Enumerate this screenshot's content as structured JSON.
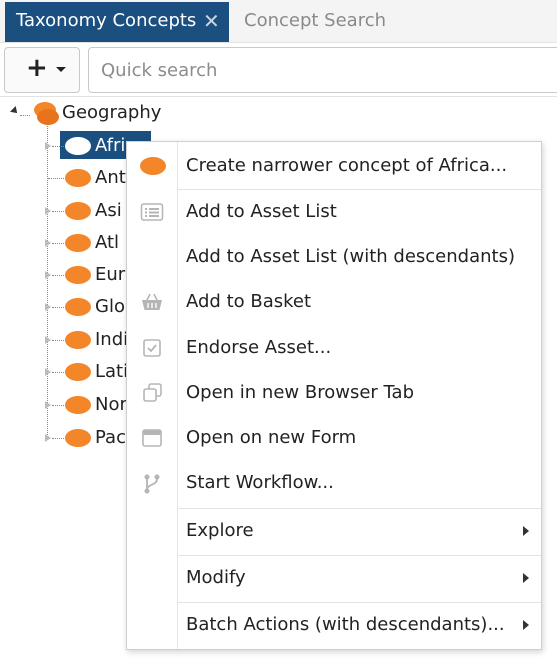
{
  "tabs": [
    {
      "label": "Taxonomy Concepts",
      "active": true
    },
    {
      "label": "Concept Search",
      "active": false
    }
  ],
  "toolbar": {
    "add_symbol": "+"
  },
  "search": {
    "placeholder": "Quick search",
    "value": ""
  },
  "tree": {
    "root": {
      "label": "Geography",
      "expanded": true
    },
    "children": [
      {
        "label": "Africa",
        "shown": "Afric",
        "selected": true
      },
      {
        "label": "Ant",
        "shown": "Ant"
      },
      {
        "label": "Asi",
        "shown": "Asi"
      },
      {
        "label": "Atl",
        "shown": "Atl"
      },
      {
        "label": "Eur",
        "shown": "Eur"
      },
      {
        "label": "Glo",
        "shown": "Glo"
      },
      {
        "label": "Indi",
        "shown": "Indi"
      },
      {
        "label": "Lati",
        "shown": "Lati"
      },
      {
        "label": "Nor",
        "shown": "Nor"
      },
      {
        "label": "Pac",
        "shown": "Pac"
      }
    ]
  },
  "context_menu": {
    "items": [
      {
        "label": "Create narrower concept of Africa...",
        "icon": "concept-oval-icon"
      },
      {
        "label": "Add to Asset List",
        "icon": "list-icon"
      },
      {
        "label": "Add to Asset List (with descendants)",
        "icon": ""
      },
      {
        "label": "Add to Basket",
        "icon": "basket-icon"
      },
      {
        "label": "Endorse Asset...",
        "icon": "checkbox-icon"
      },
      {
        "label": "Open in new Browser Tab",
        "icon": "copy-tab-icon"
      },
      {
        "label": "Open on new Form",
        "icon": "window-icon"
      },
      {
        "label": "Start Workflow...",
        "icon": "workflow-branch-icon"
      },
      {
        "label": "Explore",
        "submenu": true
      },
      {
        "label": "Modify",
        "submenu": true
      },
      {
        "label": "Batch Actions (with descendants)...",
        "submenu": true
      }
    ]
  },
  "colors": {
    "accent": "#1a4f80",
    "concept_orange": "#f4862a",
    "icon_gray": "#b5b5b5"
  }
}
